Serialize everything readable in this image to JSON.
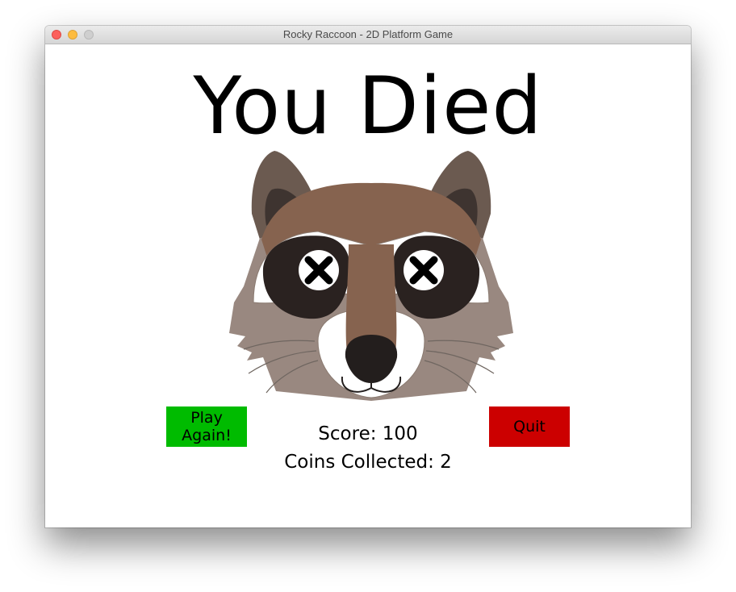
{
  "window": {
    "title": "Rocky Raccoon - 2D Platform Game"
  },
  "screen": {
    "headline": "You Died",
    "image": "dead-raccoon-face"
  },
  "buttons": {
    "play_again": "Play Again!",
    "quit": "Quit"
  },
  "stats": {
    "score": "Score: 100",
    "coins": "Coins Collected: 2"
  },
  "colors": {
    "play_again": "#00bb00",
    "quit": "#cc0000"
  }
}
